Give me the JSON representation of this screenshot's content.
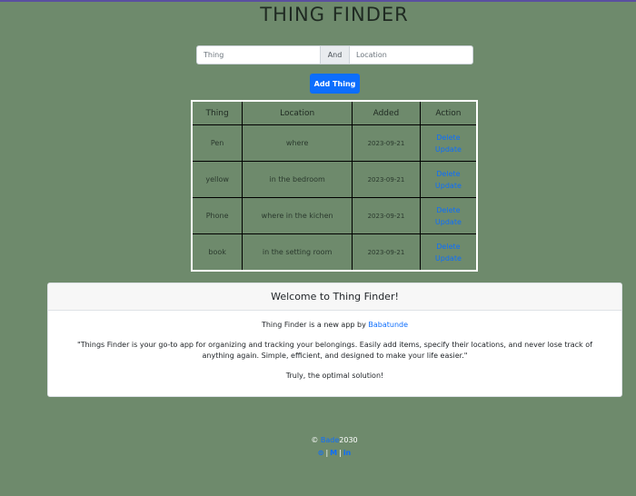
{
  "app": {
    "title": "THING FINDER"
  },
  "form": {
    "thing_placeholder": "Thing",
    "and_label": "And",
    "location_placeholder": "Location",
    "add_button": "Add Thing"
  },
  "table": {
    "headers": [
      "Thing",
      "Location",
      "Added",
      "Action"
    ],
    "rows": [
      {
        "thing": "Pen",
        "location": "where",
        "added": "2023-09-21",
        "delete": "Delete",
        "update": "Update"
      },
      {
        "thing": "yellow",
        "location": "in the bedroom",
        "added": "2023-09-21",
        "delete": "Delete",
        "update": "Update"
      },
      {
        "thing": "Phone",
        "location": "where in the kichen",
        "added": "2023-09-21",
        "delete": "Delete",
        "update": "Update"
      },
      {
        "thing": "book",
        "location": "in the setting room",
        "added": "2023-09-21",
        "delete": "Delete",
        "update": "Update"
      }
    ]
  },
  "welcome": {
    "header": "Welcome to Thing Finder!",
    "intro_prefix": "Thing Finder is a new app by ",
    "author_link": "Babatunde",
    "description": "\"Things Finder is your go-to app for organizing and tracking your belongings. Easily add items, specify their locations, and never lose track of anything again. Simple, efficient, and designed to make your life easier.\"",
    "tagline": "Truly, the optimal solution!"
  },
  "footer": {
    "copyright_symbol": "©",
    "author_link": "Bade",
    "year": "2030",
    "social_icons": [
      "github-icon",
      "medium-icon",
      "linkedin-icon"
    ],
    "social_glyphs": [
      "⊙",
      "M",
      "in"
    ],
    "separator": "|"
  },
  "colors": {
    "background": "#6e8a6c",
    "primary": "#0d6efd",
    "table_border": "#ffffff"
  }
}
